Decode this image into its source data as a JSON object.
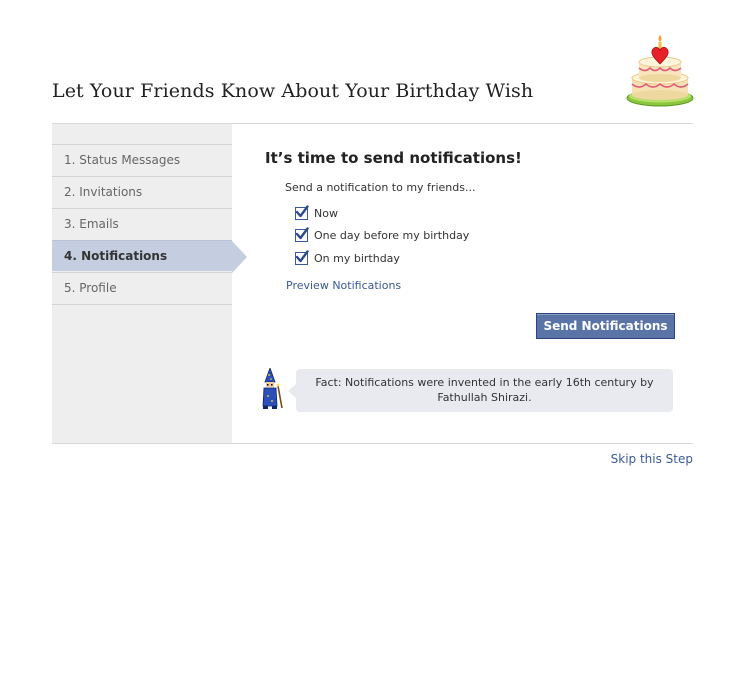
{
  "page": {
    "title": "Let Your Friends Know About Your Birthday Wish",
    "logo_icon": "birthday-cake-icon"
  },
  "sidebar": {
    "steps": [
      {
        "label": "1. Status Messages",
        "active": false
      },
      {
        "label": "2. Invitations",
        "active": false
      },
      {
        "label": "3. Emails",
        "active": false
      },
      {
        "label": "4. Notifications",
        "active": true
      },
      {
        "label": "5. Profile",
        "active": false
      }
    ]
  },
  "main": {
    "heading": "It’s time to send notifications!",
    "send_label": "Send a notification to my friends...",
    "options": [
      {
        "label": "Now",
        "checked": true
      },
      {
        "label": "One day before my birthday",
        "checked": true
      },
      {
        "label": "On my birthday",
        "checked": true
      }
    ],
    "preview_link": "Preview Notifications",
    "send_button": "Send Notifications",
    "fact": {
      "icon": "wizard-icon",
      "text": "Fact: Notifications were invented in the early 16th century by Fathullah Shirazi."
    }
  },
  "footer": {
    "skip_link": "Skip this Step"
  },
  "colors": {
    "link": "#3b5998",
    "button": "#5b74a8",
    "active_step": "#c4cee0",
    "sidebar": "#eeeeee",
    "fact_bubble": "#e8eaf0"
  }
}
